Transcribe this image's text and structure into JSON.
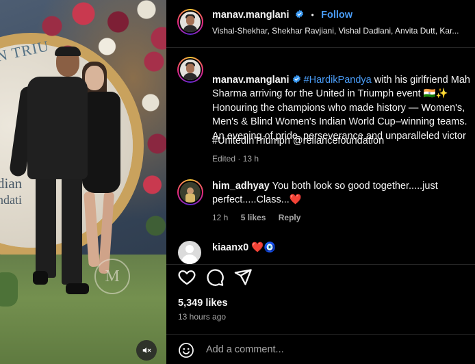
{
  "header": {
    "username": "manav.manglani",
    "follow_label": "Follow",
    "separator": "•",
    "audio": "Vishal-Shekhar, Shekhar Ravjiani, Vishal Dadlani, Anvita Dutt, Kar..."
  },
  "caption": {
    "username": "manav.manglani",
    "hashtag1": "#HardikPandya",
    "text1": " with his girlfriend Mah\nSharma arriving for the United in Triumph event 🇮🇳✨\nHonouring the champions who made history — Women's,\nMen's & Blind Women's Indian World Cup–winning teams.\nAn evening of pride, perseverance and unparalleled victor",
    "hashtags2": "#UnitedinTriumph @reliancefoundation",
    "meta": "Edited · 13 h"
  },
  "comments": [
    {
      "username": "him_adhyay",
      "text": "You both look so good together.....just perfect.....Class...❤️",
      "time": "12 h",
      "likes": "5 likes",
      "reply": "Reply"
    },
    {
      "username": "kiaanx0",
      "text": "❤️🧿"
    }
  ],
  "actions": {
    "likes": "5,349 likes",
    "time_ago": "13 hours ago"
  },
  "add_comment": {
    "placeholder": "Add a comment..."
  },
  "media": {
    "watermark": "M",
    "banner1": "N TRIU",
    "banner2": "dian",
    "banner3": "ndati"
  },
  "colors": {
    "link": "#4a9df8",
    "muted": "#a8a8a8",
    "background": "#000000"
  }
}
